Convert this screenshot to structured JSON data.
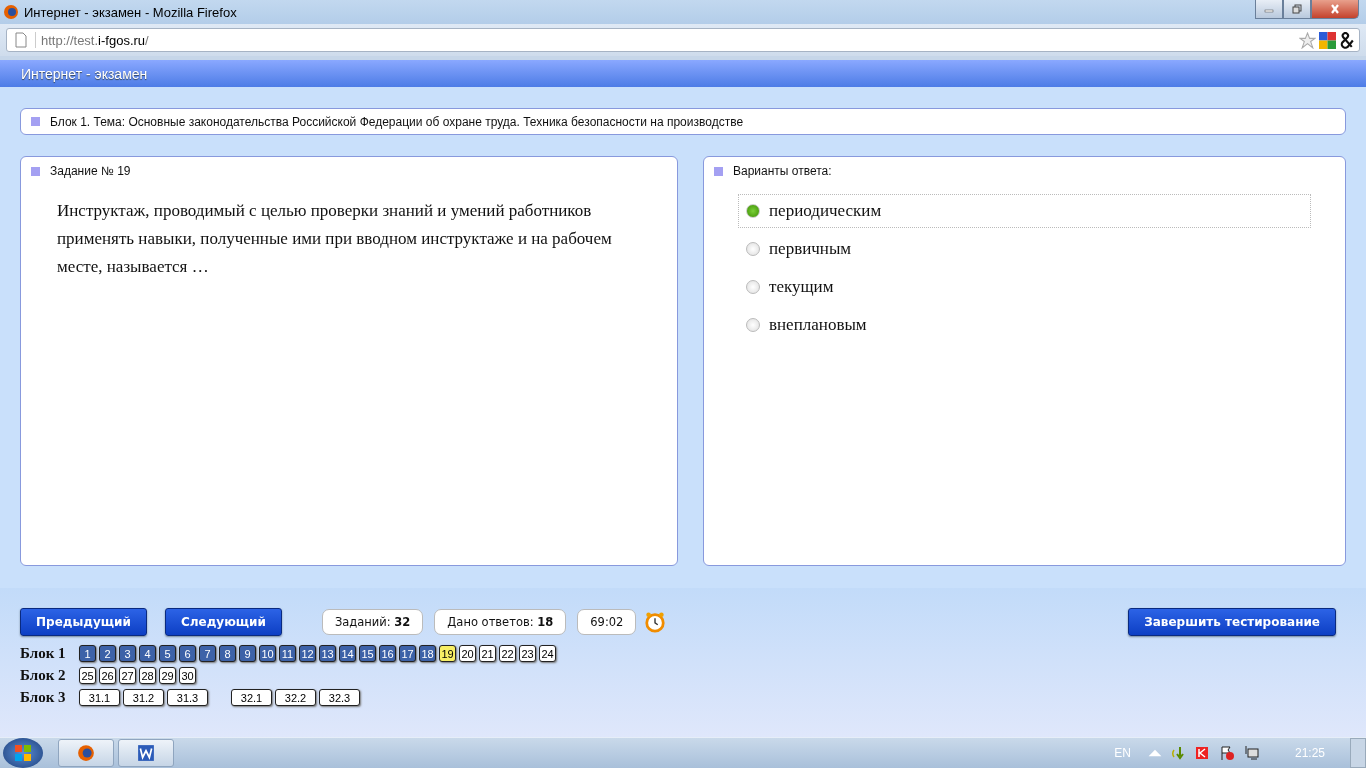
{
  "window": {
    "title": "Интернет - экзамен - Mozilla Firefox"
  },
  "address_bar": {
    "url_prefix": "http://test.",
    "url_domain": "i-fgos.ru",
    "url_suffix": "/"
  },
  "app_header": {
    "title": "Интернет - экзамен"
  },
  "block_title": "Блок 1. Тема: Основные законодательства Российской Федерации об охране труда. Техника безопасности на производстве",
  "question": {
    "heading": "Задание № 19",
    "text": "Инструктаж, проводимый с целью проверки знаний и умений работников применять навыки, полученные ими при вводном инструктаже и на рабочем месте, называется …"
  },
  "answers": {
    "heading": "Варианты ответа:",
    "options": [
      {
        "label": "периодическим",
        "selected": true
      },
      {
        "label": "первичным",
        "selected": false
      },
      {
        "label": "текущим",
        "selected": false
      },
      {
        "label": "внеплановым",
        "selected": false
      }
    ]
  },
  "buttons": {
    "previous": "Предыдущий",
    "next": "Следующий",
    "finish": "Завершить тестирование"
  },
  "stats": [
    {
      "text": "Заданий: **32**"
    },
    {
      "text": "Дано ответов: **18**"
    },
    {
      "text": "69:02"
    }
  ],
  "blocks": [
    {
      "label": "Блок 1",
      "groups": [
        [
          {
            "label": "1",
            "answered": true,
            "selected": false
          },
          {
            "label": "2",
            "answered": true,
            "selected": false
          },
          {
            "label": "3",
            "answered": true,
            "selected": false
          },
          {
            "label": "4",
            "answered": true,
            "selected": false
          },
          {
            "label": "5",
            "answered": true,
            "selected": false
          },
          {
            "label": "6",
            "answered": true,
            "selected": false
          },
          {
            "label": "7",
            "answered": true,
            "selected": false
          },
          {
            "label": "8",
            "answered": true,
            "selected": false
          },
          {
            "label": "9",
            "answered": true,
            "selected": false
          },
          {
            "label": "10",
            "answered": true,
            "selected": false
          },
          {
            "label": "11",
            "answered": true,
            "selected": false
          },
          {
            "label": "12",
            "answered": true,
            "selected": false
          },
          {
            "label": "13",
            "answered": true,
            "selected": false
          },
          {
            "label": "14",
            "answered": true,
            "selected": false
          },
          {
            "label": "15",
            "answered": true,
            "selected": false
          },
          {
            "label": "16",
            "answered": true,
            "selected": false
          },
          {
            "label": "17",
            "answered": true,
            "selected": false
          },
          {
            "label": "18",
            "answered": true,
            "selected": false
          },
          {
            "label": "19",
            "answered": false,
            "selected": true
          },
          {
            "label": "20",
            "answered": false,
            "selected": false
          },
          {
            "label": "21",
            "answered": false,
            "selected": false
          },
          {
            "label": "22",
            "answered": false,
            "selected": false
          },
          {
            "label": "23",
            "answered": false,
            "selected": false
          },
          {
            "label": "24",
            "answered": false,
            "selected": false
          }
        ]
      ]
    },
    {
      "label": "Блок 2",
      "groups": [
        [
          {
            "label": "25",
            "answered": false,
            "selected": false
          },
          {
            "label": "26",
            "answered": false,
            "selected": false
          },
          {
            "label": "27",
            "answered": false,
            "selected": false
          },
          {
            "label": "28",
            "answered": false,
            "selected": false
          },
          {
            "label": "29",
            "answered": false,
            "selected": false
          },
          {
            "label": "30",
            "answered": false,
            "selected": false
          }
        ]
      ]
    },
    {
      "label": "Блок 3",
      "groups": [
        [
          {
            "label": "31.1",
            "answered": false,
            "selected": false
          },
          {
            "label": "31.2",
            "answered": false,
            "selected": false
          },
          {
            "label": "31.3",
            "answered": false,
            "selected": false
          }
        ],
        [
          {
            "label": "32.1",
            "answered": false,
            "selected": false
          },
          {
            "label": "32.2",
            "answered": false,
            "selected": false
          },
          {
            "label": "32.3",
            "answered": false,
            "selected": false
          }
        ]
      ]
    }
  ],
  "taskbar": {
    "language": "EN",
    "clock": "21:25"
  }
}
